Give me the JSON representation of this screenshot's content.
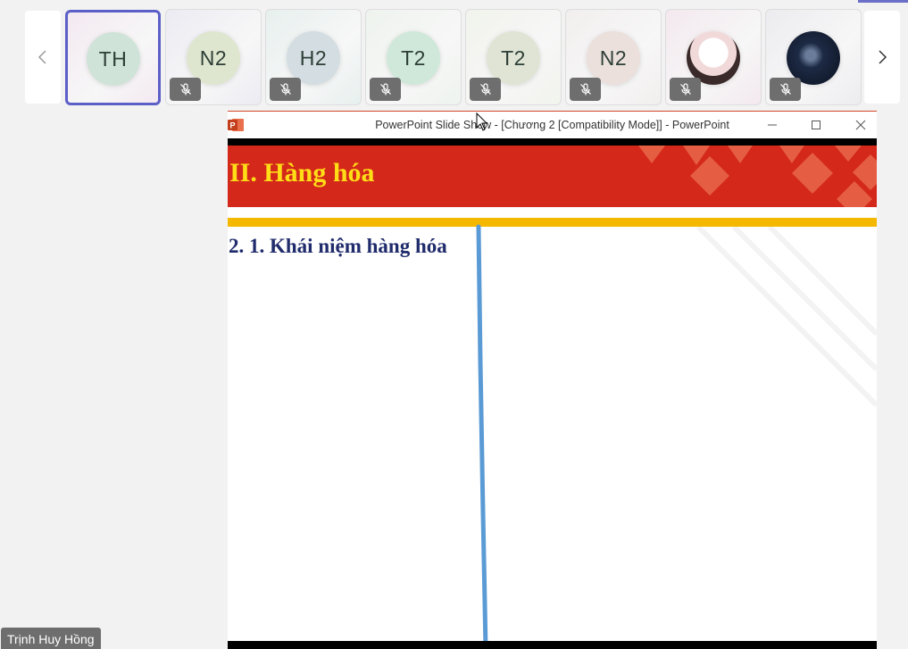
{
  "participants": [
    {
      "initials": "TH",
      "type": "initials",
      "active": true,
      "muted": false,
      "bg": "#cfe3d8",
      "tile_tint": "#f3e9f1"
    },
    {
      "initials": "N2",
      "type": "initials",
      "active": false,
      "muted": true,
      "bg": "#dfe6cf",
      "tile_tint": "#ecebf3"
    },
    {
      "initials": "H2",
      "type": "initials",
      "active": false,
      "muted": true,
      "bg": "#d3dde2",
      "tile_tint": "#e7f0ee"
    },
    {
      "initials": "T2",
      "type": "initials",
      "active": false,
      "muted": true,
      "bg": "#cfe8d9",
      "tile_tint": "#eef3ee"
    },
    {
      "initials": "T2",
      "type": "initials",
      "active": false,
      "muted": true,
      "bg": "#dfe4d5",
      "tile_tint": "#f1f3ec"
    },
    {
      "initials": "N2",
      "type": "initials",
      "active": false,
      "muted": true,
      "bg": "#ebe0dc",
      "tile_tint": "#f2eeee"
    },
    {
      "initials": "",
      "type": "photo-a",
      "active": false,
      "muted": true,
      "bg": "",
      "tile_tint": "#f3e8ee"
    },
    {
      "initials": "",
      "type": "photo-b",
      "active": false,
      "muted": true,
      "bg": "",
      "tile_tint": "#ecebef"
    }
  ],
  "nav": {
    "prev_icon": "chevron-left-icon",
    "next_icon": "chevron-right-icon"
  },
  "ppt": {
    "window_title": "PowerPoint Slide Show - [Chương 2 [Compatibility Mode]] - PowerPoint",
    "slide_heading": "II. Hàng hóa",
    "slide_subheading": "2. 1. Khái niệm hàng hóa",
    "colors": {
      "banner": "#d4281a",
      "heading": "#ffdd17",
      "gold_bar": "#f5b800",
      "subheading": "#1f2b6b",
      "pen": "#5b9bd5"
    }
  },
  "presenter_name": "Trịnh Huy Hồng"
}
